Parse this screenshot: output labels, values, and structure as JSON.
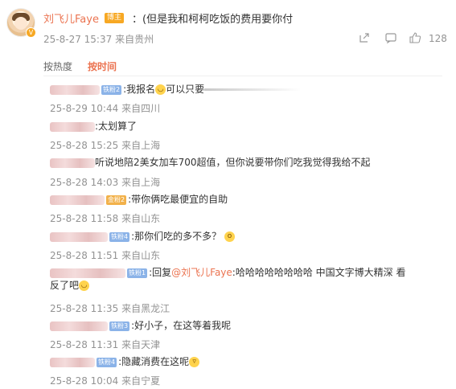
{
  "post": {
    "author": "刘飞儿Faye",
    "author_tag": "博主",
    "text": "：(但是我和柯柯吃饭的费用要你付",
    "date": "25-8-27 15:37",
    "location": "来自贵州",
    "like_count": "128"
  },
  "sort_tabs": [
    "按热度",
    "按时间"
  ],
  "replies": [
    {
      "fan": "铁粉2",
      "fan_color": "blue",
      "text": ":我报名",
      "emoji": "😋",
      "text_after": "可以只要",
      "date": "25-8-29 10:44",
      "location": "来自四川"
    },
    {
      "text": ":太划算了",
      "date": "25-8-28 15:25",
      "location": "来自上海"
    },
    {
      "text": "听说地陪2美女加车700超值，但你说要带你们吃我觉得我给不起",
      "date": "25-8-28 14:03",
      "location": "来自上海"
    },
    {
      "fan": "金粉2",
      "fan_color": "gold",
      "text": ":带你俩吃最便宜的自助",
      "date": "25-8-28 11:58",
      "location": "来自山东"
    },
    {
      "fan": "铁粉4",
      "fan_color": "blue",
      "text": ":那你们吃的多不多？",
      "emoji": "😮",
      "date": "25-8-28 11:51",
      "location": "来自山东"
    },
    {
      "fan": "铁粉1",
      "fan_color": "blue",
      "text": ":回复",
      "mention": "@刘飞儿Faye",
      "text_after": ":哈哈哈哈哈哈哈哈  中国文字博大精深 看",
      "line2": "反了吧",
      "emoji2": "😋",
      "date": "25-8-28 11:35",
      "location": "来自黑龙江"
    },
    {
      "fan": "铁粉3",
      "fan_color": "blue",
      "text": ":好小子，在这等着我呢",
      "date": "25-8-28 11:31",
      "location": "来自天津"
    },
    {
      "fan": "铁粉4",
      "fan_color": "blue",
      "text": ":隐藏消费在这呢",
      "emoji": "🤭",
      "date": "25-8-28 10:04",
      "location": "来自宁夏"
    }
  ]
}
